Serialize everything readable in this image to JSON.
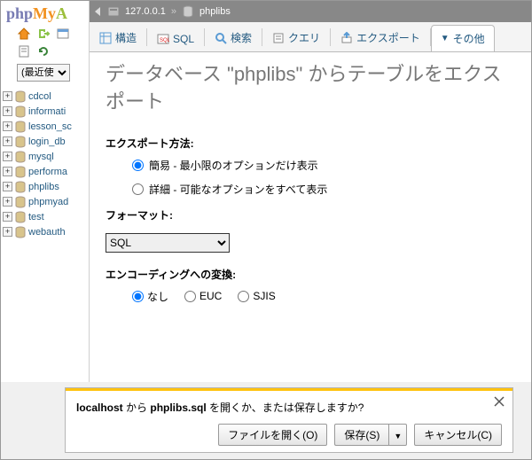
{
  "logo": {
    "php": "php",
    "my": "My",
    "a": "A"
  },
  "sidebar": {
    "recent_label": "(最近使",
    "databases": [
      {
        "name": "cdcol"
      },
      {
        "name": "informati"
      },
      {
        "name": "lesson_sc"
      },
      {
        "name": "login_db"
      },
      {
        "name": "mysql"
      },
      {
        "name": "performa"
      },
      {
        "name": "phplibs"
      },
      {
        "name": "phpmyad"
      },
      {
        "name": "test"
      },
      {
        "name": "webauth"
      }
    ]
  },
  "location": {
    "server": "127.0.0.1",
    "database": "phplibs",
    "separator": "»"
  },
  "tabs": {
    "structure": "構造",
    "sql": "SQL",
    "search": "検索",
    "query": "クエリ",
    "export": "エクスポート",
    "more": "その他"
  },
  "page": {
    "title": "データベース \"phplibs\" からテーブルをエクスポート",
    "export_method_label": "エクスポート方法:",
    "method_quick": "簡易 - 最小限のオプションだけ表示",
    "method_custom": "詳細 - 可能なオプションをすべて表示",
    "format_label": "フォーマット:",
    "format_value": "SQL",
    "encoding_label": "エンコーディングへの変換:",
    "enc_none": "なし",
    "enc_euc": "EUC",
    "enc_sjis": "SJIS"
  },
  "dialog": {
    "host": "localhost",
    "mid1": " から ",
    "filename": "phplibs.sql",
    "mid2": " を開くか、または保存しますか?",
    "open_btn": "ファイルを開く(O)",
    "save_btn": "保存(S)",
    "cancel_btn": "キャンセル(C)"
  }
}
